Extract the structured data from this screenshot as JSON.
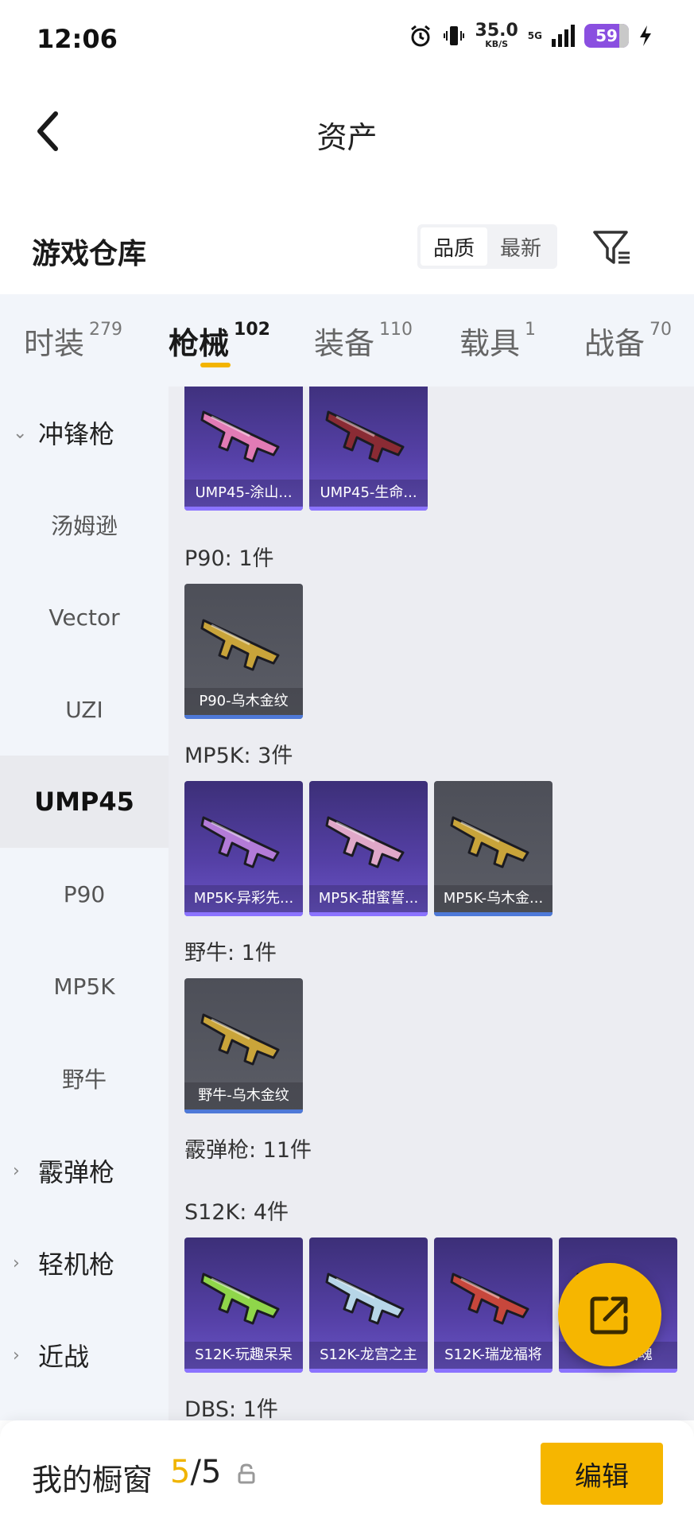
{
  "status_bar": {
    "time": "12:06",
    "net_speed": "35.0",
    "net_unit": "KB/S",
    "network": "5G",
    "battery": "59",
    "icons": [
      "alarm-icon",
      "vibrate-icon",
      "signal-icon",
      "battery-icon",
      "charging-icon"
    ]
  },
  "header": {
    "title": "资产",
    "back_icon": "chevron-left-icon"
  },
  "warehouse": {
    "title": "游戏仓库",
    "sort_options": [
      "品质",
      "最新"
    ],
    "selected_sort": "品质",
    "filter_icon": "filter-icon"
  },
  "tabs": [
    {
      "label": "时装",
      "count": "279"
    },
    {
      "label": "枪械",
      "count": "102",
      "active": true
    },
    {
      "label": "装备",
      "count": "110"
    },
    {
      "label": "载具",
      "count": "1"
    },
    {
      "label": "战备",
      "count": "70"
    }
  ],
  "sidebar": [
    {
      "label": "冲锋枪",
      "type": "category",
      "expanded": true
    },
    {
      "label": "汤姆逊",
      "type": "sub"
    },
    {
      "label": "Vector",
      "type": "sub"
    },
    {
      "label": "UZI",
      "type": "sub"
    },
    {
      "label": "UMP45",
      "type": "sub",
      "active": true
    },
    {
      "label": "P90",
      "type": "sub"
    },
    {
      "label": "MP5K",
      "type": "sub"
    },
    {
      "label": "野牛",
      "type": "sub"
    },
    {
      "label": "霰弹枪",
      "type": "category"
    },
    {
      "label": "轻机枪",
      "type": "category"
    },
    {
      "label": "近战",
      "type": "category"
    }
  ],
  "groups": [
    {
      "label": "",
      "items": [
        {
          "name": "UMP45-涂山...",
          "rarity": "purple",
          "color": "#e27bb5"
        },
        {
          "name": "UMP45-生命...",
          "rarity": "purple",
          "color": "#8a2b34"
        }
      ]
    },
    {
      "label": "P90: 1件",
      "items": [
        {
          "name": "P90-乌木金纹",
          "rarity": "gray",
          "color": "#c9a43a"
        }
      ]
    },
    {
      "label": "MP5K: 3件",
      "items": [
        {
          "name": "MP5K-异彩先...",
          "rarity": "purple",
          "color": "#b37bd8"
        },
        {
          "name": "MP5K-甜蜜誓...",
          "rarity": "purple",
          "color": "#e0a8c9"
        },
        {
          "name": "MP5K-乌木金...",
          "rarity": "gray",
          "color": "#c9a43a"
        }
      ]
    },
    {
      "label": "野牛: 1件",
      "items": [
        {
          "name": "野牛-乌木金纹",
          "rarity": "gray",
          "color": "#c9a43a"
        }
      ]
    },
    {
      "label": "霰弹枪: 11件",
      "items": []
    },
    {
      "label": "S12K: 4件",
      "items": [
        {
          "name": "S12K-玩趣呆呆",
          "rarity": "purple",
          "color": "#8fd64a"
        },
        {
          "name": "S12K-龙宫之主",
          "rarity": "purple",
          "color": "#b7d6e8"
        },
        {
          "name": "S12K-瑞龙福将",
          "rarity": "purple",
          "color": "#c7473c"
        },
        {
          "name": "S12K-战魂",
          "rarity": "purple",
          "color": "#d6a23a"
        }
      ]
    },
    {
      "label": "DBS: 1件",
      "items": []
    }
  ],
  "fab": {
    "icon": "share-external-icon"
  },
  "bottom_bar": {
    "label": "我的橱窗",
    "current": "5",
    "separator": "/",
    "total": "5",
    "lock_icon": "lock-icon",
    "edit_label": "编辑"
  }
}
